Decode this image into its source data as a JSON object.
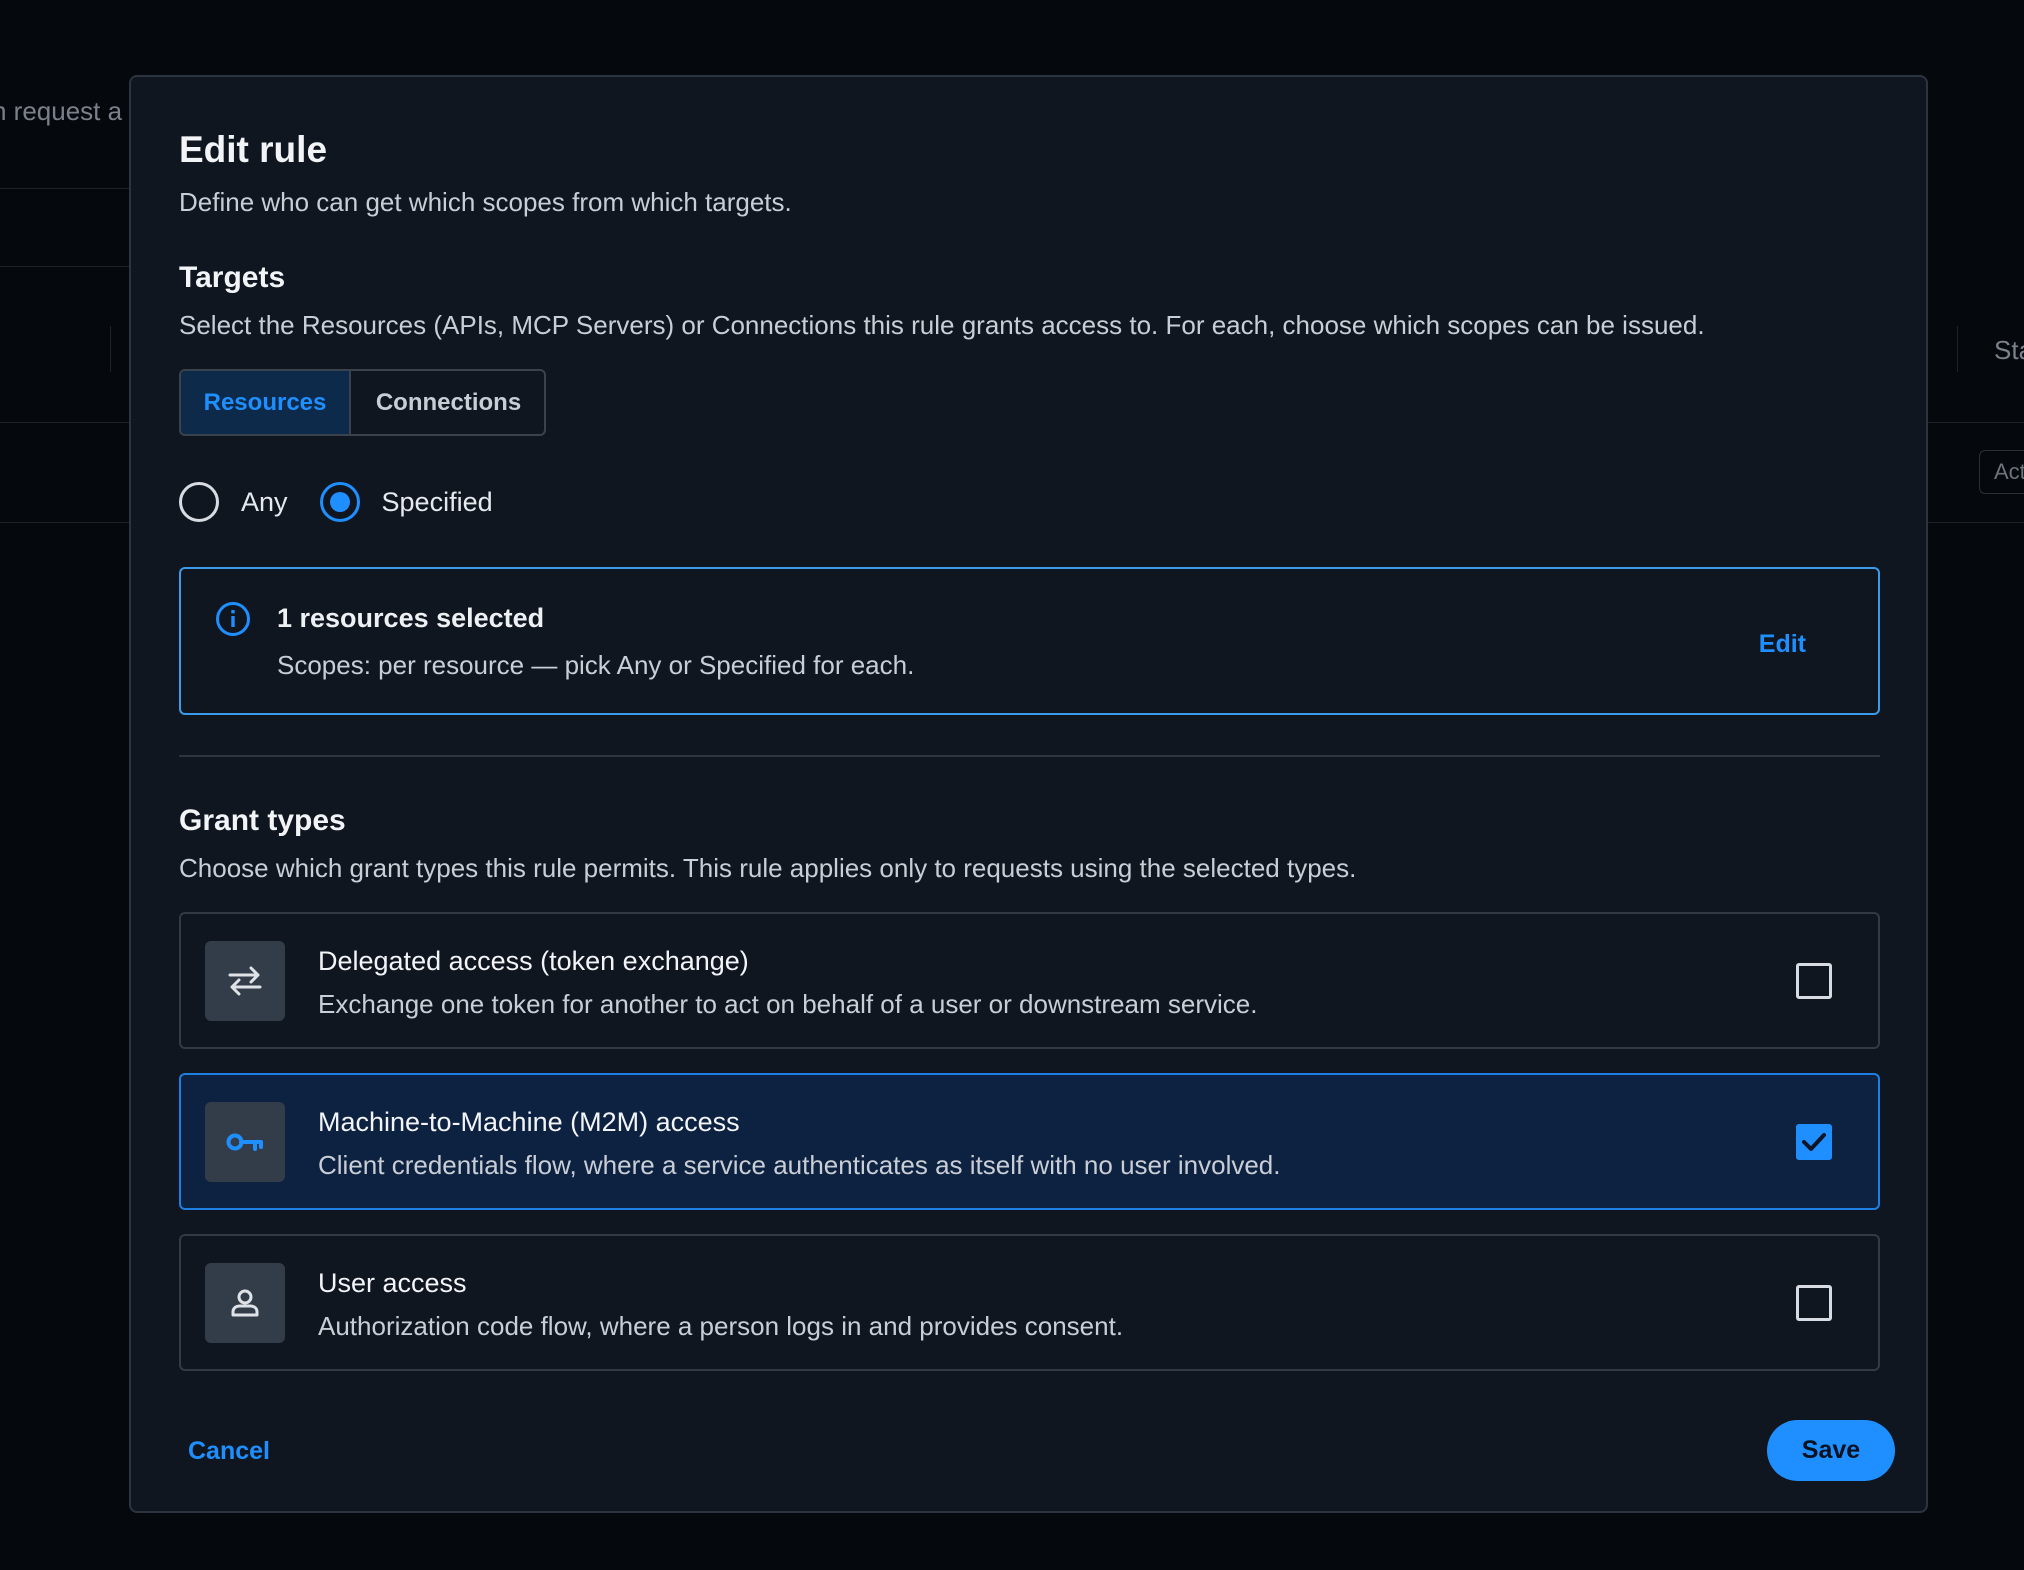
{
  "background": {
    "left_text": "n request a",
    "right_header": "Sta",
    "right_button": "Act"
  },
  "modal": {
    "title": "Edit rule",
    "subtitle": "Define who can get which scopes from which targets."
  },
  "targets": {
    "heading": "Targets",
    "description": "Select the Resources (APIs, MCP Servers) or Connections this rule grants access to. For each, choose which scopes can be issued.",
    "tabs": [
      {
        "label": "Resources",
        "active": true
      },
      {
        "label": "Connections",
        "active": false
      }
    ],
    "radio_options": [
      {
        "label": "Any",
        "checked": false
      },
      {
        "label": "Specified",
        "checked": true
      }
    ],
    "info": {
      "icon": "info-icon",
      "title": "1 resources selected",
      "subtitle": "Scopes: per resource — pick Any or Specified for each.",
      "edit_label": "Edit"
    }
  },
  "grant_types": {
    "heading": "Grant types",
    "description": "Choose which grant types this rule permits. This rule applies only to requests using the selected types.",
    "options": [
      {
        "icon": "swap-arrows-icon",
        "title": "Delegated access (token exchange)",
        "description": "Exchange one token for another to act on behalf of a user or downstream service.",
        "checked": false
      },
      {
        "icon": "key-icon",
        "title": "Machine-to-Machine (M2M) access",
        "description": "Client credentials flow, where a service authenticates as itself with no user involved.",
        "checked": true
      },
      {
        "icon": "user-icon",
        "title": "User access",
        "description": "Authorization code flow, where a person logs in and provides consent.",
        "checked": false
      }
    ]
  },
  "footer": {
    "cancel_label": "Cancel",
    "save_label": "Save"
  },
  "colors": {
    "accent": "#1f8fff",
    "modal_bg": "#0f1620",
    "backdrop": "#05080d"
  }
}
